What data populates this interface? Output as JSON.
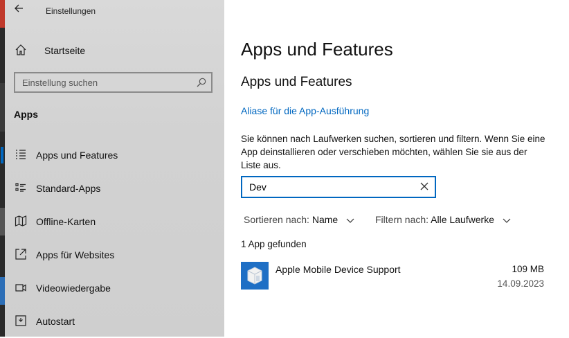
{
  "window": {
    "title": "Einstellungen",
    "back_icon": "back-arrow-icon"
  },
  "sidebar": {
    "home_label": "Startseite",
    "search_placeholder": "Einstellung suchen",
    "section_title": "Apps",
    "items": [
      {
        "label": "Apps und Features",
        "icon": "list-icon",
        "active": true
      },
      {
        "label": "Standard-Apps",
        "icon": "default-apps-icon",
        "active": false
      },
      {
        "label": "Offline-Karten",
        "icon": "map-icon",
        "active": false
      },
      {
        "label": "Apps für Websites",
        "icon": "open-in-app-icon",
        "active": false
      },
      {
        "label": "Videowiedergabe",
        "icon": "video-icon",
        "active": false
      },
      {
        "label": "Autostart",
        "icon": "startup-icon",
        "active": false
      }
    ]
  },
  "main": {
    "page_title": "Apps und Features",
    "section_title": "Apps und Features",
    "alias_link": "Aliase für die App-Ausführung",
    "description": "Sie können nach Laufwerken suchen, sortieren und filtern. Wenn Sie eine App deinstallieren oder verschieben möchten, wählen Sie sie aus der Liste aus.",
    "search_value": "Dev",
    "sort_label": "Sortieren nach:",
    "sort_value": "Name",
    "filter_label": "Filtern nach:",
    "filter_value": "Alle Laufwerke",
    "result_count": "1 App gefunden",
    "apps": [
      {
        "name": "Apple Mobile Device Support",
        "size": "109 MB",
        "date": "14.09.2023"
      }
    ]
  },
  "colors": {
    "accent": "#0067c0",
    "app_tile": "#1e6fc5",
    "sidebar_bg": "#d4d4d4"
  }
}
